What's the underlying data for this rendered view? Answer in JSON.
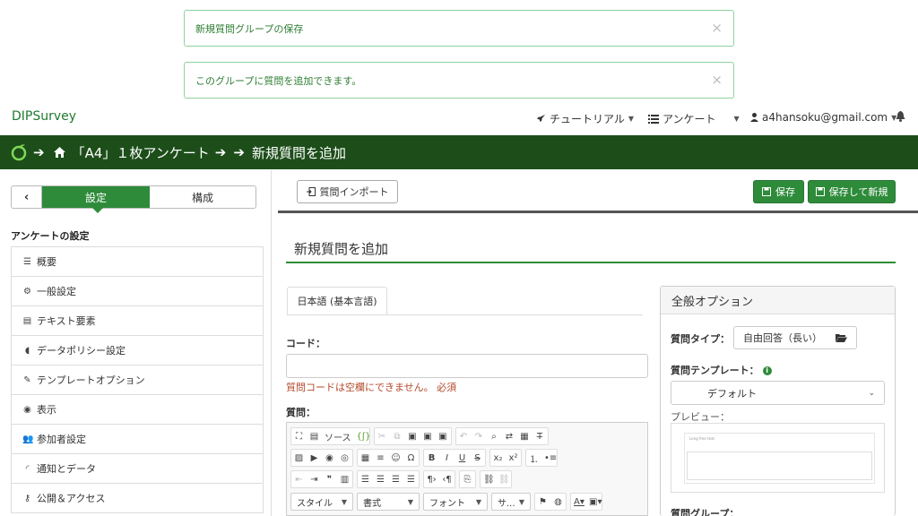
{
  "alerts": [
    {
      "text": "新規質問グループの保存",
      "close": "×"
    },
    {
      "text": "このグループに質問を追加できます。",
      "close": "×"
    }
  ],
  "nav": {
    "brand": "DIPSurvey",
    "tutorial": "チュートリアル",
    "surveys": "アンケート",
    "user": "a4hansoku@gmail.com"
  },
  "breadcrumb": {
    "survey": "「A4」１枚アンケート",
    "current": "新規質問を追加"
  },
  "sidebar": {
    "tab_settings": "設定",
    "tab_structure": "構成",
    "heading": "アンケートの設定",
    "items": [
      {
        "label": "概要",
        "icon": "list-icon"
      },
      {
        "label": "一般設定",
        "icon": "cogs-icon"
      },
      {
        "label": "テキスト要素",
        "icon": "file-text-icon"
      },
      {
        "label": "データポリシー設定",
        "icon": "shield-icon"
      },
      {
        "label": "テンプレートオプション",
        "icon": "paintbrush-icon"
      },
      {
        "label": "表示",
        "icon": "eye-slash-icon"
      },
      {
        "label": "参加者設定",
        "icon": "users-icon"
      },
      {
        "label": "通知とデータ",
        "icon": "rss-icon"
      },
      {
        "label": "公開＆アクセス",
        "icon": "key-icon"
      }
    ]
  },
  "toolbar": {
    "import": "質問インポート",
    "save": "保存",
    "save_new": "保存して新規"
  },
  "page_title": "新規質問を追加",
  "lang_tab": "日本語 (基本言語)",
  "form": {
    "code_label": "コード：",
    "code_error": "質問コードは空欄にできません。 必須",
    "question_label": "質問："
  },
  "editor": {
    "source": "ソース",
    "style": "スタイル",
    "format": "書式",
    "font": "フォント",
    "size": "サ..."
  },
  "panel": {
    "title": "全般オプション",
    "type_label": "質問タイプ：",
    "type_value": "自由回答（長い）",
    "template_label": "質問テンプレート：",
    "template_value": "デフォルト",
    "preview_label": "プレビュー：",
    "preview_text": "Long free text",
    "group_label": "質問グループ："
  },
  "colors": {
    "accent": "#2e8b3a",
    "breadcrumb_bg": "#1d4e1a",
    "error": "#b34a2b"
  }
}
